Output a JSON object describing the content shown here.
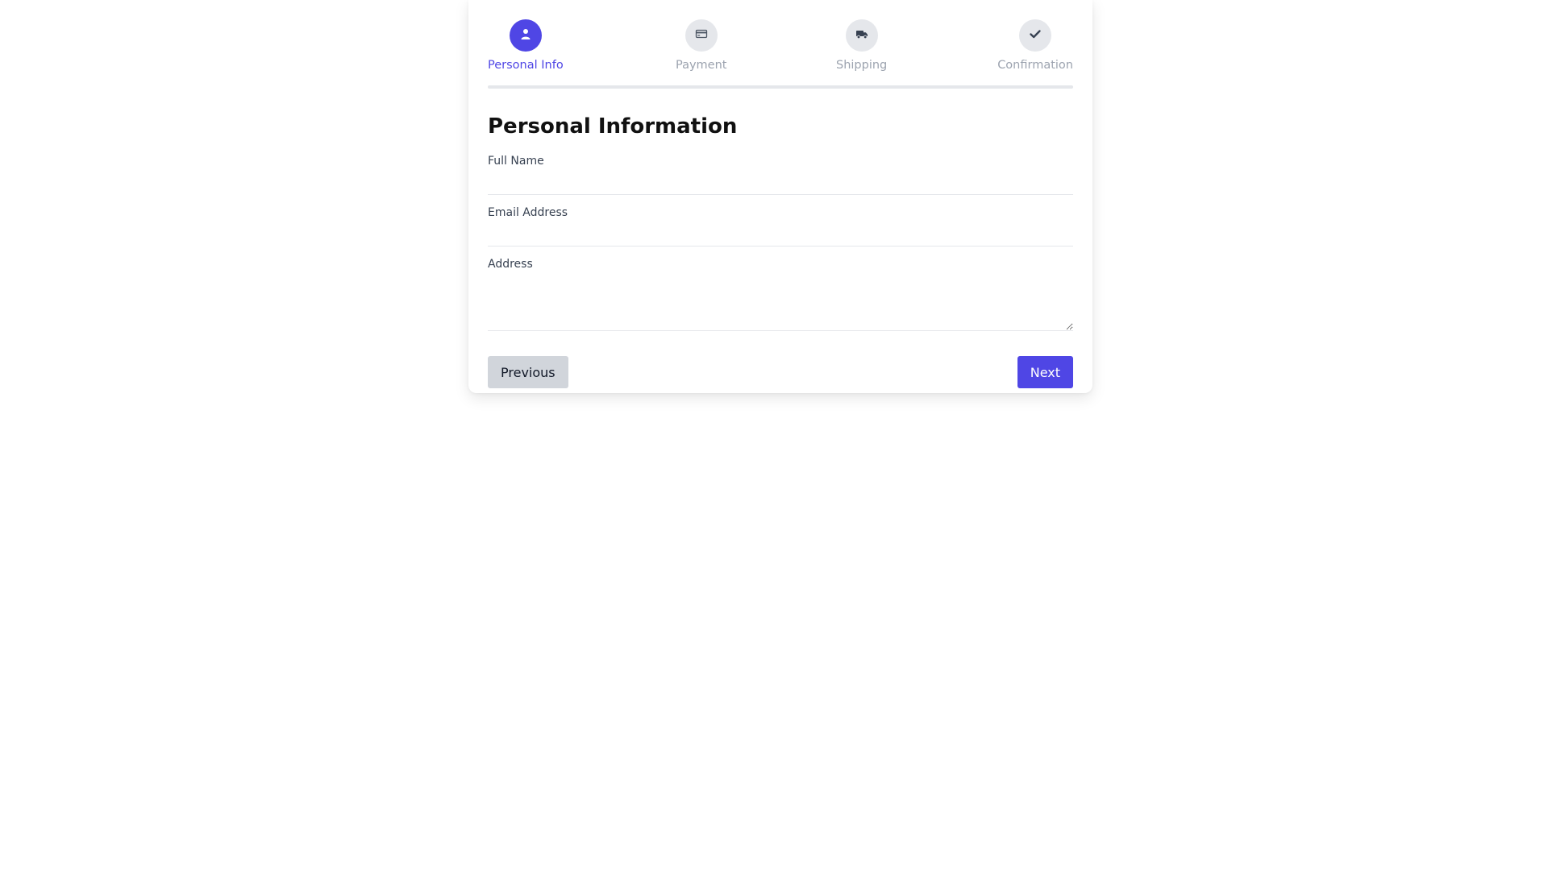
{
  "steps": [
    {
      "label": "Personal Info",
      "icon": "user-icon",
      "active": true
    },
    {
      "label": "Payment",
      "icon": "credit-card-icon",
      "active": false
    },
    {
      "label": "Shipping",
      "icon": "truck-icon",
      "active": false
    },
    {
      "label": "Confirmation",
      "icon": "check-icon",
      "active": false
    }
  ],
  "progress_fraction": 0,
  "form": {
    "title": "Personal Information",
    "full_name_label": "Full Name",
    "full_name_value": "",
    "email_label": "Email Address",
    "email_value": "",
    "address_label": "Address",
    "address_value": ""
  },
  "buttons": {
    "previous_label": "Previous",
    "next_label": "Next"
  },
  "colors": {
    "accent": "#4f46e5",
    "inactive_circle": "#e5e7eb",
    "inactive_text": "#9ca3af"
  }
}
